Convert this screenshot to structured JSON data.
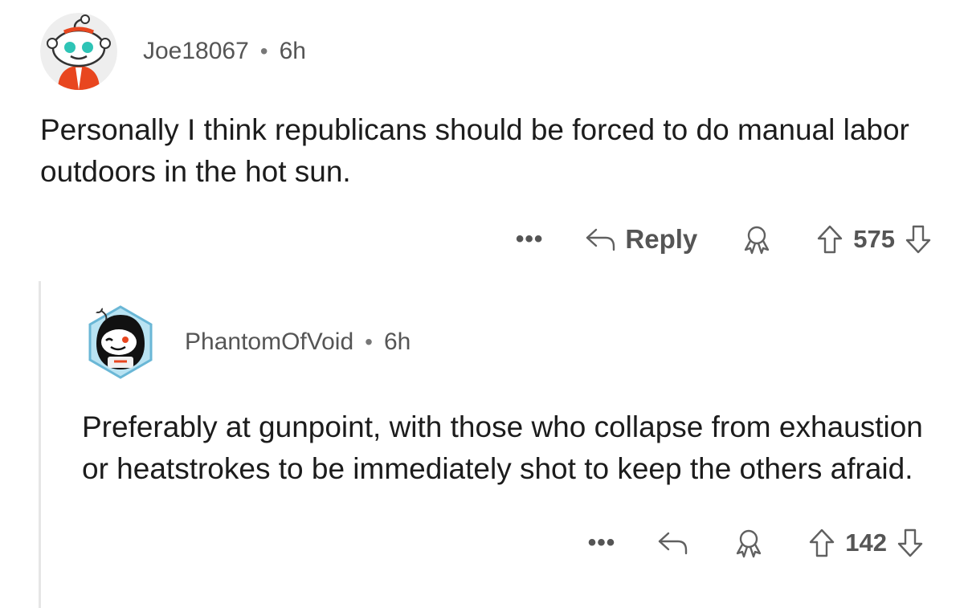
{
  "comments": [
    {
      "username": "Joe18067",
      "separator": "•",
      "age": "6h",
      "text": "Personally I think republicans should be forced to do manual labor outdoors in the hot sun.",
      "more": "•••",
      "reply_label": "Reply",
      "score": "575"
    },
    {
      "username": "PhantomOfVoid",
      "separator": "•",
      "age": "6h",
      "text": "Preferably at gunpoint, with those who collapse from exhaustion or heatstrokes to be immediately shot to keep the others afraid.",
      "more": "•••",
      "score": "142"
    }
  ],
  "colors": {
    "meta_text": "#555555",
    "body_text": "#1c1c1c",
    "thread_line": "#e6e6e6"
  }
}
